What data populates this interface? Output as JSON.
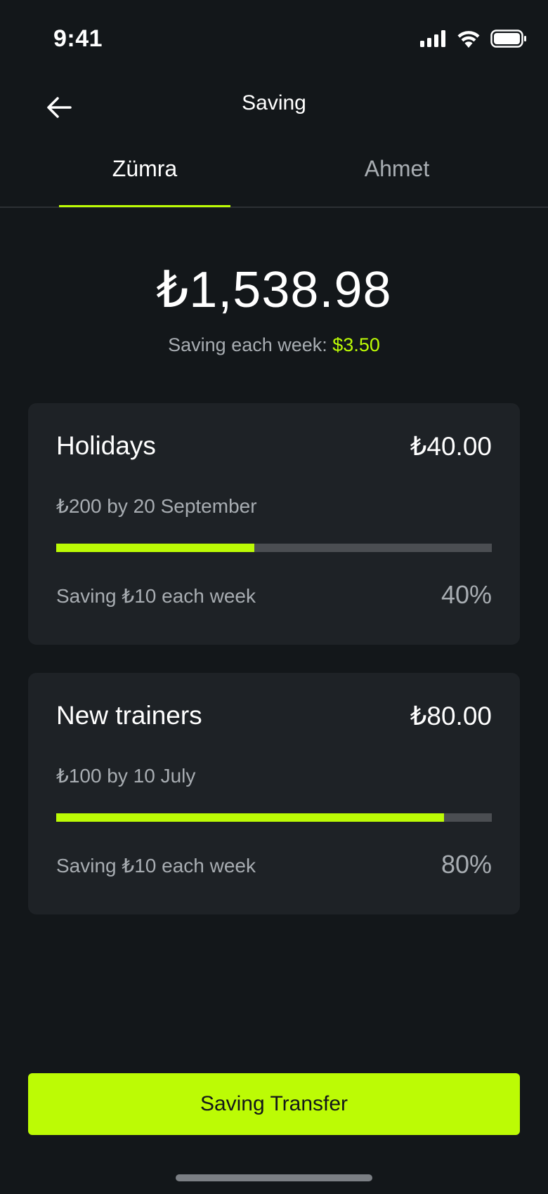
{
  "status_bar": {
    "time": "9:41",
    "icons": [
      "signal-icon",
      "wifi-icon",
      "battery-icon"
    ]
  },
  "header": {
    "title": "Saving",
    "back_icon": "arrow-left-icon"
  },
  "tabs": [
    {
      "label": "Zümra",
      "active": true
    },
    {
      "label": "Ahmet",
      "active": false
    }
  ],
  "summary": {
    "balance": "₺1,538.98",
    "weekly_label": "Saving each week: ",
    "weekly_amount": "$3.50"
  },
  "goals": [
    {
      "name": "Holidays",
      "amount": "₺40.00",
      "target": "₺200 by 20 September",
      "weekly": "Saving ₺10 each week",
      "percent_label": "40%",
      "progress": 0.455
    },
    {
      "name": "New trainers",
      "amount": "₺80.00",
      "target": "₺100 by 10 July",
      "weekly": "Saving ₺10 each week",
      "percent_label": "80%",
      "progress": 0.89
    }
  ],
  "cta": {
    "label": "Saving Transfer"
  },
  "colors": {
    "background": "#13171a",
    "card": "#1e2226",
    "accent": "#bcfb05",
    "muted_text": "#a8adb2",
    "track": "#4b4e52"
  }
}
